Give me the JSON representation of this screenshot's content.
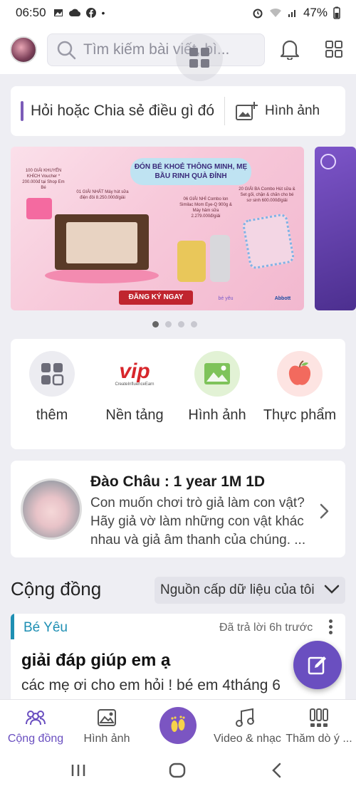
{
  "status_bar": {
    "time": "06:50",
    "battery": "47%"
  },
  "search": {
    "placeholder": "Tìm kiếm bài viết, bì..."
  },
  "composer": {
    "prompt": "Hỏi hoặc Chia sẻ điều gì đó",
    "image_label": "Hình ảnh"
  },
  "banner": {
    "headline": "ĐÓN BÉ KHOẺ THÔNG MINH, MẸ BẦU RINH QUÀ ĐỈNH",
    "prize_consolation": "100 GIẢI KHUYẾN KHÍCH Voucher * 200.000đ tại Shop Em Bé",
    "prize_first": "01 GIẢI NHẤT Máy hút sữa điện đôi 8.250.000đ/giải",
    "prize_second": "06 GIẢI NHÌ Combo lon Similac Mom Eye-Q 900g & Máy hâm sữa 2.279.000đ/giải",
    "prize_third": "20 GIẢI BA Combo Hút sữa & Set gối, chặn & chăn cho bé sơ sinh 600.000đ/giải",
    "register": "ĐĂNG KÝ NGAY",
    "brand_1": "bé yêu",
    "brand_2": "Abbott",
    "pagination_active": 1,
    "pagination_total": 4
  },
  "shortcuts": [
    {
      "label": "thêm"
    },
    {
      "label": "Nền tảng",
      "logo_text": "vip",
      "logo_sub": "CreateInfluenceEarn"
    },
    {
      "label": "Hình ảnh"
    },
    {
      "label": "Thực phẩm"
    }
  ],
  "diary": {
    "title": "Đào Châu : 1 year 1M 1D",
    "body": "Con muốn chơi trò giả làm con vật? Hãy giả vờ làm những con vật khác nhau và giả âm thanh của chúng. ..."
  },
  "community": {
    "title": "Cộng đồng",
    "feed_select": "Nguồn cấp dữ liệu của tôi"
  },
  "post": {
    "category": "Bé Yêu",
    "time": "Đã trả lời 6h trước",
    "title": "giải đáp giúp em ạ",
    "body": "các mẹ ơi cho em hỏi ! bé em 4tháng 6"
  },
  "bottom_nav": {
    "items": [
      {
        "label": "Cộng đồng",
        "icon": "people-icon"
      },
      {
        "label": "Hình ảnh",
        "icon": "image-icon"
      },
      {
        "label": "",
        "icon": "footprints-icon"
      },
      {
        "label": "Video & nhạc",
        "icon": "music-icon"
      },
      {
        "label": "Thăm dò ý ...",
        "icon": "poll-icon"
      }
    ]
  },
  "colors": {
    "accent": "#6a4fc0",
    "category": "#1e8fb3"
  }
}
